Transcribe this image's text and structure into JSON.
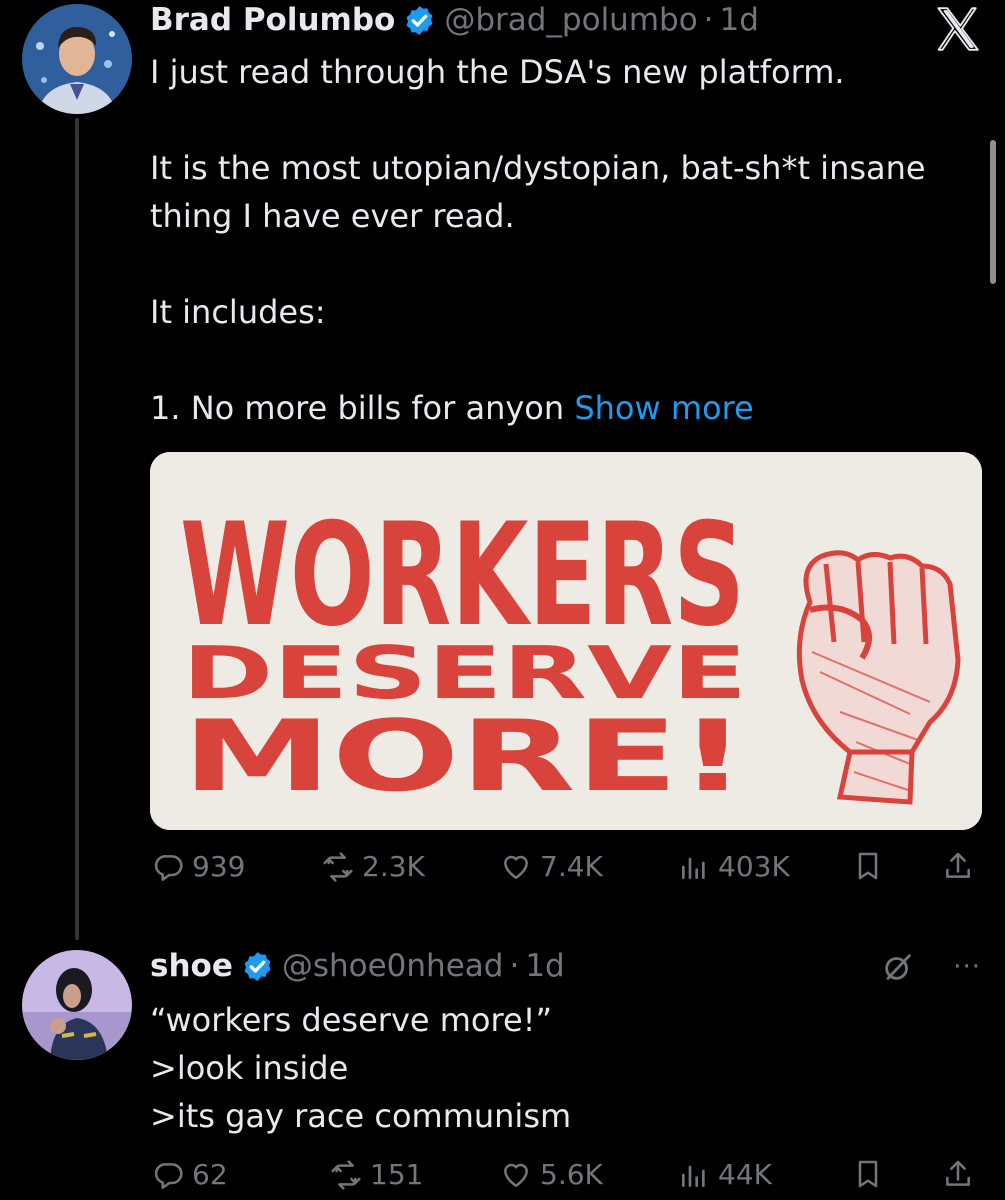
{
  "tweet1": {
    "display_name": "Brad Polumbo",
    "handle": "@brad_polumbo",
    "separator": "·",
    "time": "1d",
    "lines": [
      "I just read through the DSA's new platform.",
      "",
      "It is the most utopian/dystopian, bat-sh*t insane",
      "thing I have ever read.",
      "",
      "It includes:",
      "",
      "1. No more bills for anyon"
    ],
    "show_more": "Show more",
    "media_text": {
      "line1": "WORKERS",
      "line2": "DESERVE",
      "line3": "MORE!"
    },
    "replies": "939",
    "reposts": "2.3K",
    "likes": "7.4K",
    "views": "403K"
  },
  "tweet2": {
    "display_name": "shoe",
    "handle": "@shoe0nhead",
    "separator": "·",
    "time": "1d",
    "lines": [
      "“workers deserve more!”",
      ">look inside",
      ">its gay race communism"
    ],
    "more": "···",
    "replies": "62",
    "reposts": "151",
    "likes": "5.6K",
    "views": "44K"
  },
  "colors": {
    "background": "#000000",
    "text": "#e7e9ea",
    "muted": "#71767b",
    "link": "#1d9bf0",
    "verified": "#1d9bf0",
    "poster_red": "#d8433b",
    "poster_bg": "#eeeae4"
  },
  "icons": [
    "x-logo-icon",
    "verified-badge-icon",
    "reply-icon",
    "repost-icon",
    "like-icon",
    "views-icon",
    "bookmark-icon",
    "share-icon",
    "grok-icon",
    "more-icon"
  ]
}
